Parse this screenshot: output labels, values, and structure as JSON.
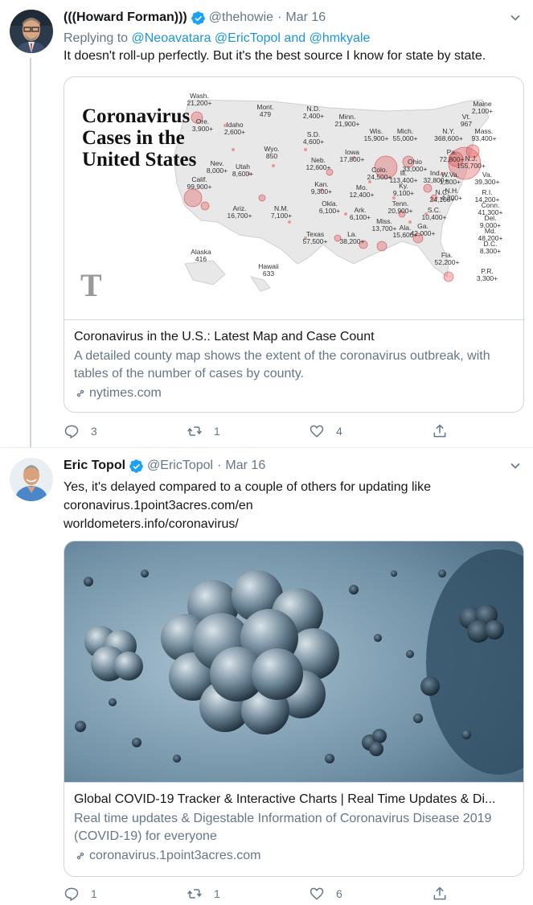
{
  "colors": {
    "link": "#1b95e0",
    "verified": "#1da1f2",
    "muted": "#657786",
    "text": "#14171a",
    "border": "#ccd6dd"
  },
  "tweet1": {
    "display_name": "(((Howard Forman)))",
    "handle": "@thehowie",
    "date": "Mar 16",
    "replying_prefix": "Replying to",
    "replying_user1": "@Neoavatara",
    "replying_user2": "@EricTopol",
    "replying_and": "and",
    "replying_user3": "@hmkyale",
    "text": "It doesn't roll-up perfectly. But it's the best source I know for state by state.",
    "card": {
      "map_title": "Coronavirus Cases in the United States",
      "title": "Coronavirus in the U.S.: Latest Map and Case Count",
      "description": "A detailed county map shows the extent of the coronavirus outbreak, with tables of the number of cases by county.",
      "domain": "nytimes.com",
      "map_labels": [
        {
          "state": "Wash.",
          "count": "21,200+"
        },
        {
          "state": "Mont.",
          "count": "479"
        },
        {
          "state": "N.D.",
          "count": "2,400+"
        },
        {
          "state": "Minn.",
          "count": "21,900+"
        },
        {
          "state": "Maine",
          "count": "2,100+"
        },
        {
          "state": "Vt.",
          "count": "967"
        },
        {
          "state": "Ore.",
          "count": "3,900+"
        },
        {
          "state": "Idaho",
          "count": "2,600+"
        },
        {
          "state": "S.D.",
          "count": "4,600+"
        },
        {
          "state": "Wis.",
          "count": "15,900+"
        },
        {
          "state": "Mich.",
          "count": "55,000+"
        },
        {
          "state": "N.Y.",
          "count": "368,600+"
        },
        {
          "state": "Mass.",
          "count": "93,400+"
        },
        {
          "state": "Wyo.",
          "count": "850"
        },
        {
          "state": "Iowa",
          "count": "17,800+"
        },
        {
          "state": "Pa.",
          "count": "72,800+"
        },
        {
          "state": "N.J.",
          "count": "155,700+"
        },
        {
          "state": "Nev.",
          "count": "8,000+"
        },
        {
          "state": "Utah",
          "count": "8,600+"
        },
        {
          "state": "Neb.",
          "count": "12,600+"
        },
        {
          "state": "Ohio",
          "count": "33,000+"
        },
        {
          "state": "Colo.",
          "count": "24,500+"
        },
        {
          "state": "Ill.",
          "count": "113,400+"
        },
        {
          "state": "Ind.",
          "count": "32,800+"
        },
        {
          "state": "W.Va.",
          "count": "1,800+"
        },
        {
          "state": "Va.",
          "count": "39,300+"
        },
        {
          "state": "N.H.",
          "count": "4,200+"
        },
        {
          "state": "Calif.",
          "count": "99,900+"
        },
        {
          "state": "Kan.",
          "count": "9,300+"
        },
        {
          "state": "Mo.",
          "count": "12,400+"
        },
        {
          "state": "Ky.",
          "count": "9,100+"
        },
        {
          "state": "N.C.",
          "count": "24,100+"
        },
        {
          "state": "R.I.",
          "count": "14,200+"
        },
        {
          "state": "Conn.",
          "count": "41,300+"
        },
        {
          "state": "Okla.",
          "count": "6,100+"
        },
        {
          "state": "Tenn.",
          "count": "20,900+"
        },
        {
          "state": "S.C.",
          "count": "10,400+"
        },
        {
          "state": "Del.",
          "count": "9,000+"
        },
        {
          "state": "Ariz.",
          "count": "16,700+"
        },
        {
          "state": "N.M.",
          "count": "7,100+"
        },
        {
          "state": "Ark.",
          "count": "6,100+"
        },
        {
          "state": "Md.",
          "count": "48,200+"
        },
        {
          "state": "Miss.",
          "count": "13,700+"
        },
        {
          "state": "Ala.",
          "count": "15,600+"
        },
        {
          "state": "Ga.",
          "count": "42,000+"
        },
        {
          "state": "Texas",
          "count": "57,500+"
        },
        {
          "state": "La.",
          "count": "38,200+"
        },
        {
          "state": "D.C.",
          "count": "8,300+"
        },
        {
          "state": "Alaska",
          "count": "416"
        },
        {
          "state": "Fla.",
          "count": "52,200+"
        },
        {
          "state": "Hawaii",
          "count": "633"
        },
        {
          "state": "P.R.",
          "count": "3,300+"
        }
      ]
    },
    "reply_count": "3",
    "retweet_count": "1",
    "like_count": "4"
  },
  "tweet2": {
    "display_name": "Eric Topol",
    "handle": "@EricTopol",
    "date": "Mar 16",
    "text": "Yes, it's delayed compared to a couple of others for updating like",
    "link1": "coronavirus.1point3acres.com/en",
    "link2": "worldometers.info/coronavirus/",
    "card": {
      "title": "Global COVID-19 Tracker & Interactive Charts | Real Time Updates & Di...",
      "description": "Real time updates & Digestable Information of Coronavirus Disease 2019 (COVID-19) for everyone",
      "domain": "coronavirus.1point3acres.com"
    },
    "reply_count": "1",
    "retweet_count": "1",
    "like_count": "6"
  }
}
